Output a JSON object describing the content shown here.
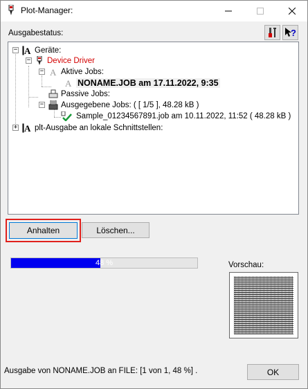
{
  "window": {
    "title": "Plot-Manager:"
  },
  "status_label": "Ausgabestatus:",
  "toolbar": {
    "tools_icon": "tools-icon",
    "help_icon": "context-help-icon"
  },
  "tree": {
    "root": "Geräte:",
    "device": "Device Driver",
    "active_jobs": "Aktive Jobs:",
    "active_job": "NONAME.JOB am 17.11.2022, 9:35",
    "passive_jobs": "Passive Jobs:",
    "output_jobs": "Ausgegebene Jobs: ( [ 1/5 ], 48.28 kB )",
    "output_job_item": "Sample_01234567891.job am 10.11.2022, 11:52 ( 48.28 kB )",
    "local_output": "plt-Ausgabe an lokale Schnittstellen:"
  },
  "buttons": {
    "pause": "Anhalten",
    "delete": "Löschen...",
    "ok": "OK"
  },
  "progress": {
    "percent": 48,
    "label": "48 %"
  },
  "preview_label": "Vorschau:",
  "statusline": "Ausgabe von NONAME.JOB an FILE: [1 von 1, 48 %] .",
  "colors": {
    "progress_fill": "#0000f0",
    "device_text": "#d40000",
    "highlight_border": "#e0201c"
  }
}
